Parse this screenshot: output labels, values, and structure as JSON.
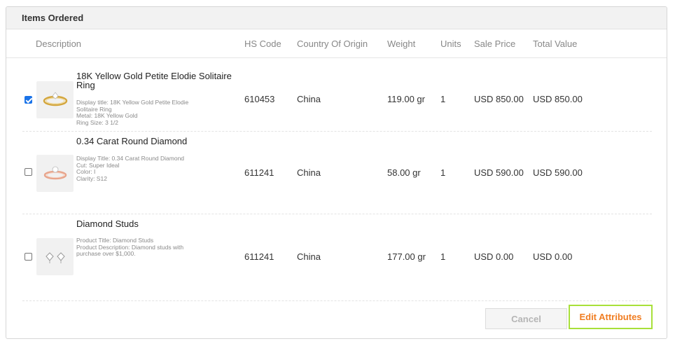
{
  "panel": {
    "title": "Items Ordered"
  },
  "columns": {
    "description": "Description",
    "hs_code": "HS Code",
    "country": "Country Of Origin",
    "weight": "Weight",
    "units": "Units",
    "sale_price": "Sale Price",
    "total_value": "Total Value"
  },
  "items": [
    {
      "checked": true,
      "title": "18K Yellow Gold Petite Elodie Solitaire Ring",
      "details": [
        "Display title: 18K Yellow Gold Petite Elodie Solitaire Ring",
        "Metal: 18K Yellow Gold",
        "Ring Size: 3 1/2"
      ],
      "hs_code": "610453",
      "country": "China",
      "weight": "119.00 gr",
      "units": "1",
      "sale_price": "USD 850.00",
      "total_value": "USD 850.00"
    },
    {
      "checked": false,
      "title": "0.34 Carat Round Diamond",
      "details": [
        "Display Title: 0.34 Carat Round Diamond",
        "Cut: Super Ideal",
        "Color: I",
        "Clarity: S12"
      ],
      "hs_code": "611241",
      "country": "China",
      "weight": "58.00 gr",
      "units": "1",
      "sale_price": "USD 590.00",
      "total_value": "USD 590.00"
    },
    {
      "checked": false,
      "title": "Diamond Studs",
      "details": [
        "Product Title: Diamond Studs",
        "Product Description: Diamond studs with purchase over $1,000."
      ],
      "hs_code": "611241",
      "country": "China",
      "weight": "177.00 gr",
      "units": "1",
      "sale_price": "USD 0.00",
      "total_value": "USD 0.00"
    }
  ],
  "buttons": {
    "cancel": "Cancel",
    "edit_attributes": "Edit Attributes"
  },
  "colors": {
    "accent": "#f07d22",
    "highlight": "#a8e03a",
    "checkbox": "#1a73e8"
  },
  "icons": {
    "item1": "yellow-gold-ring-icon",
    "item2": "rose-gold-ring-icon",
    "item3": "diamond-studs-icon"
  }
}
